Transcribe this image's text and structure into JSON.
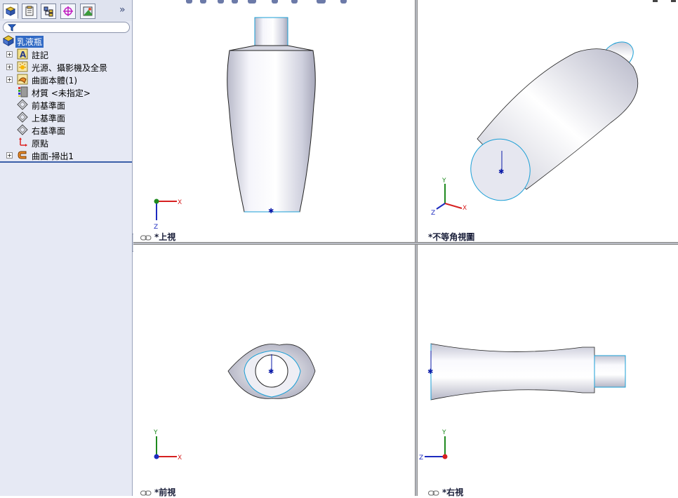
{
  "feature_tree": {
    "root": "乳液瓶",
    "items": [
      {
        "label": "註記",
        "icon": "annotations-icon",
        "expandable": true
      },
      {
        "label": "光源、攝影機及全景",
        "icon": "lights-cameras-scene-icon",
        "expandable": true
      },
      {
        "label": "曲面本體(1)",
        "icon": "surface-bodies-icon",
        "expandable": true
      },
      {
        "label": "材質 <未指定>",
        "icon": "material-icon",
        "expandable": false
      },
      {
        "label": "前基準面",
        "icon": "plane-icon",
        "expandable": false
      },
      {
        "label": "上基準面",
        "icon": "plane-icon",
        "expandable": false
      },
      {
        "label": "右基準面",
        "icon": "plane-icon",
        "expandable": false
      },
      {
        "label": "原點",
        "icon": "origin-icon",
        "expandable": false
      },
      {
        "label": "曲面-掃出1",
        "icon": "sweep-surface-icon",
        "expandable": true
      }
    ]
  },
  "viewports": {
    "top_left": {
      "label": "*上視"
    },
    "top_right": {
      "label": "*不等角視圖"
    },
    "bottom_left": {
      "label": "*前視"
    },
    "bottom_right": {
      "label": "*右視"
    }
  },
  "triad": {
    "x": "X",
    "y": "Y",
    "z": "Z"
  },
  "colors": {
    "tree_bg": "#e6e9f4",
    "selection": "#316ac5",
    "edge": "#1b9fd6",
    "sketch": "#0a1aa8",
    "axis_x": "#d62020",
    "axis_y": "#1e8a1e",
    "axis_z": "#1d2bbf"
  }
}
